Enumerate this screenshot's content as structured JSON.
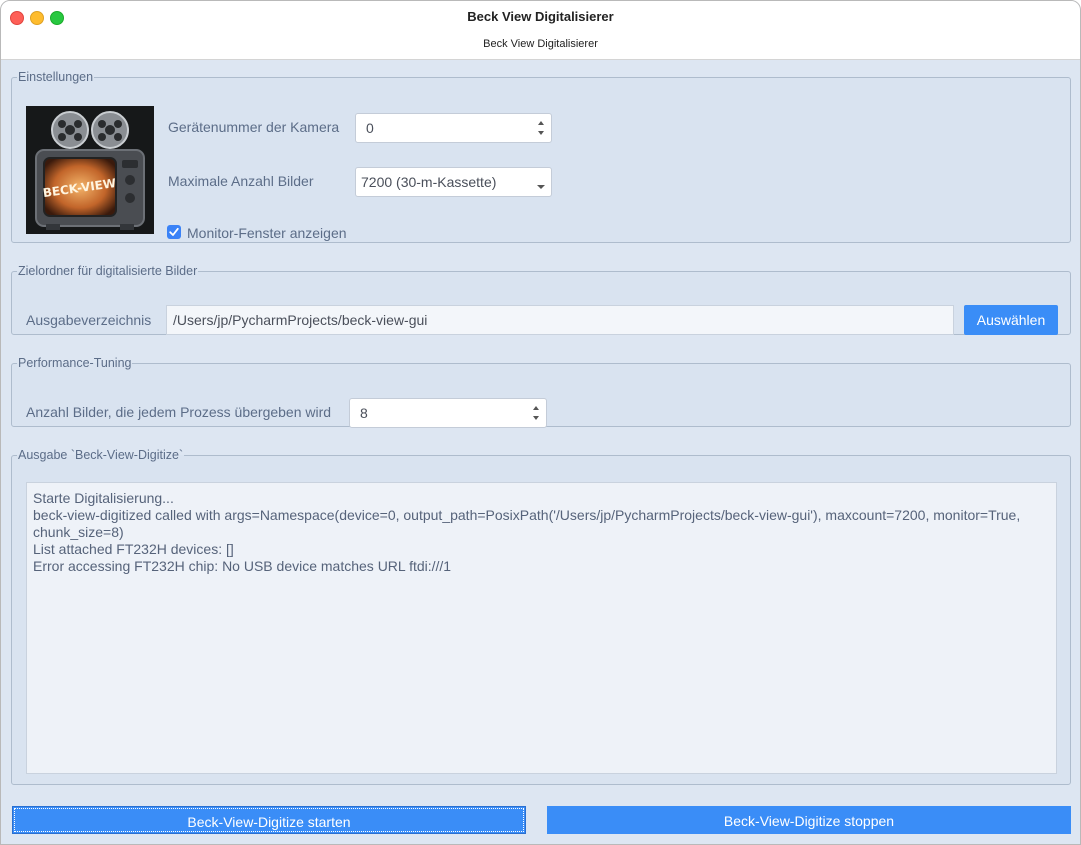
{
  "window": {
    "title": "Beck View Digitalisierer",
    "subtitle": "Beck View Digitalisierer"
  },
  "settings": {
    "legend": "Einstellungen",
    "logo_text": "BECK-VIEW",
    "camera_label": "Gerätenummer der Kamera",
    "camera_value": "0",
    "max_frames_label": "Maximale Anzahl Bilder",
    "max_frames_value": "7200 (30-m-Kassette)",
    "monitor_label": "Monitor-Fenster anzeigen",
    "monitor_checked": true
  },
  "target": {
    "legend": "Zielordner für digitalisierte Bilder",
    "output_label": "Ausgabeverzeichnis",
    "output_value": "/Users/jp/PycharmProjects/beck-view-gui",
    "choose_button": "Auswählen"
  },
  "perf": {
    "legend": "Performance-Tuning",
    "chunk_label": "Anzahl Bilder, die jedem Prozess übergeben wird",
    "chunk_value": "8"
  },
  "output": {
    "legend": "Ausgabe `Beck-View-Digitize`",
    "lines": [
      "Starte Digitalisierung...",
      "beck-view-digitized called with args=Namespace(device=0, output_path=PosixPath('/Users/jp/PycharmProjects/beck-view-gui'), maxcount=7200, monitor=True, chunk_size=8)",
      "List attached FT232H devices: []",
      "Error accessing FT232H chip: No USB device matches URL ftdi:///1"
    ]
  },
  "buttons": {
    "start": "Beck-View-Digitize starten",
    "stop": "Beck-View-Digitize stoppen"
  },
  "colors": {
    "accent": "#3a8df7",
    "window_bg": "#dde6f2",
    "label": "#5c6d88"
  }
}
